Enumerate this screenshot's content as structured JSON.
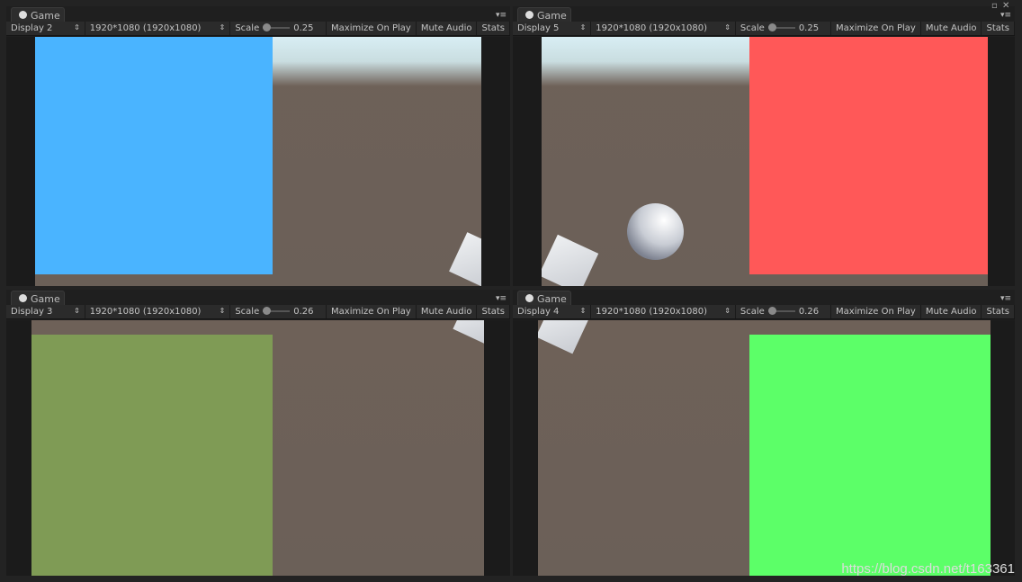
{
  "panels": [
    {
      "tab": "Game",
      "display": "Display 2",
      "resolution": "1920*1080 (1920x1080)",
      "scale_label": "Scale",
      "scale_value": "0.25",
      "maximize": "Maximize On Play",
      "mute": "Mute Audio",
      "stats": "Stats",
      "rect_color": "#4ab4ff"
    },
    {
      "tab": "Game",
      "display": "Display 5",
      "resolution": "1920*1080 (1920x1080)",
      "scale_label": "Scale",
      "scale_value": "0.25",
      "maximize": "Maximize On Play",
      "mute": "Mute Audio",
      "stats": "Stats",
      "rect_color": "#ff5858"
    },
    {
      "tab": "Game",
      "display": "Display 3",
      "resolution": "1920*1080 (1920x1080)",
      "scale_label": "Scale",
      "scale_value": "0.26",
      "maximize": "Maximize On Play",
      "mute": "Mute Audio",
      "stats": "Stats",
      "rect_color": "#7f9b55"
    },
    {
      "tab": "Game",
      "display": "Display 4",
      "resolution": "1920*1080 (1920x1080)",
      "scale_label": "Scale",
      "scale_value": "0.26",
      "maximize": "Maximize On Play",
      "mute": "Mute Audio",
      "stats": "Stats",
      "rect_color": "#5cff68"
    }
  ],
  "watermark": "https://blog.csdn.net/t163361"
}
